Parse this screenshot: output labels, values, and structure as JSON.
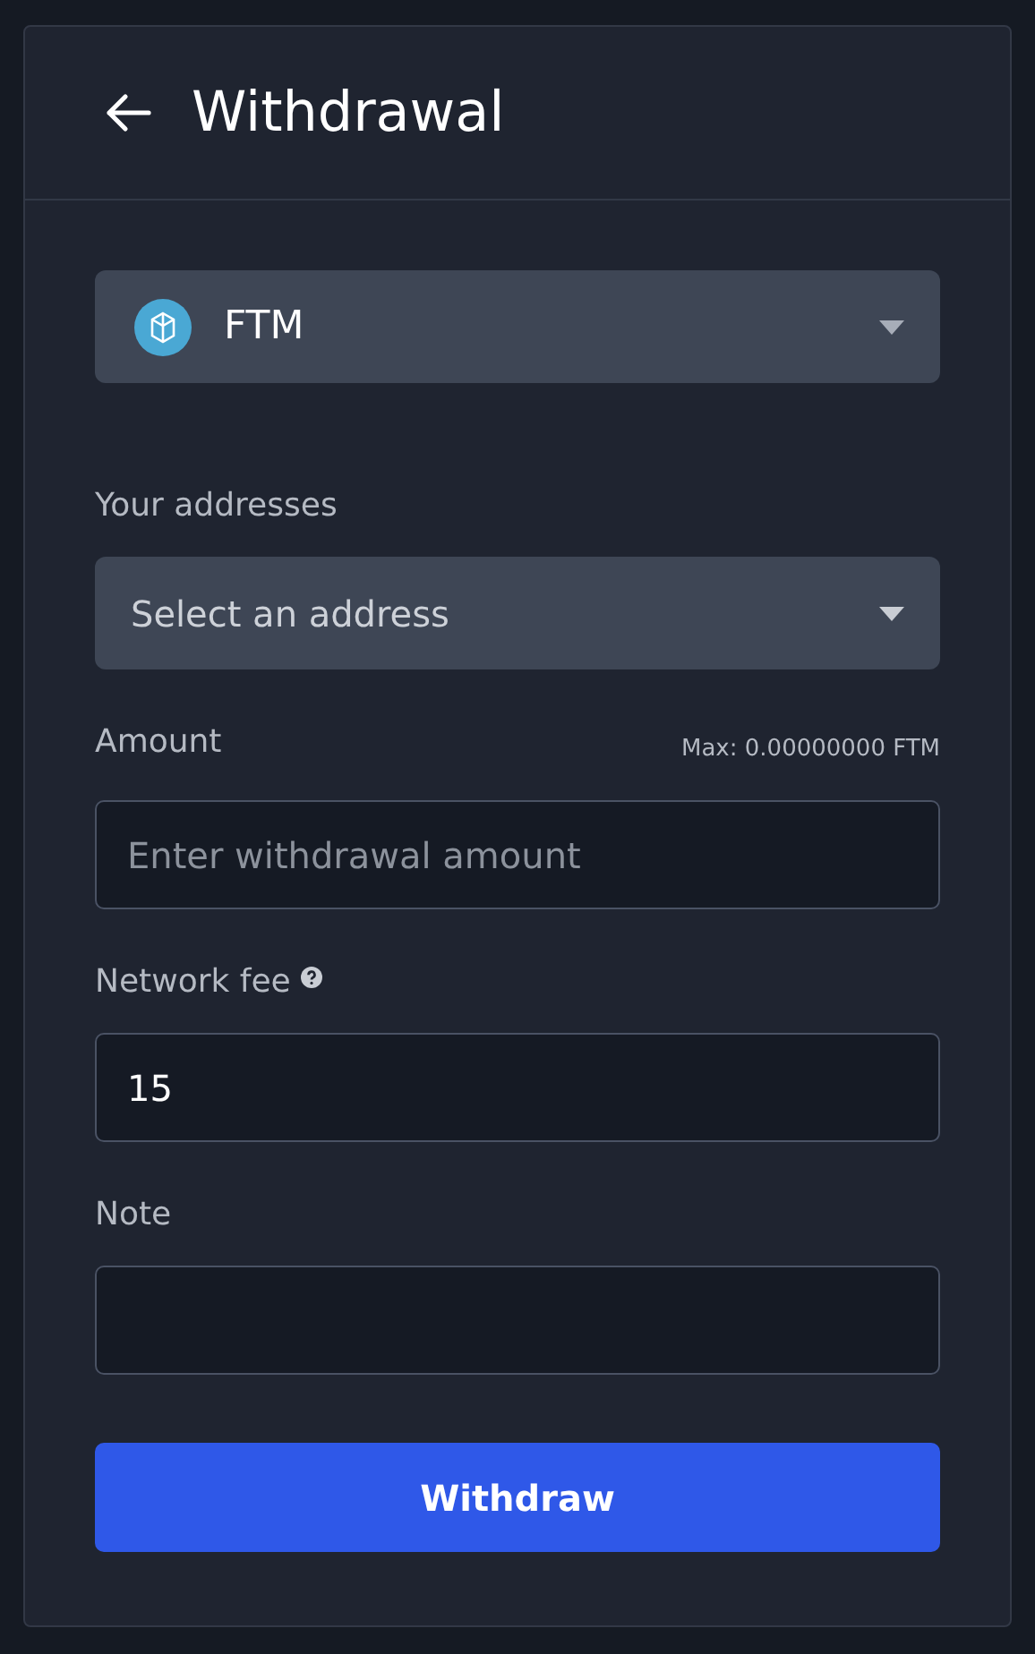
{
  "header": {
    "title": "Withdrawal"
  },
  "coin_select": {
    "value": "FTM"
  },
  "fields": [
    {
      "kind": "select",
      "label": "Your addresses",
      "placeholder": "Select an address"
    },
    {
      "kind": "input",
      "label": "Amount",
      "hint": "Max: 0.00000000 FTM",
      "placeholder": "Enter withdrawal amount"
    },
    {
      "kind": "input",
      "label": "Network fee",
      "help": true,
      "value": "15"
    },
    {
      "kind": "input",
      "label": "Note"
    }
  ],
  "submit_button": "Withdraw"
}
